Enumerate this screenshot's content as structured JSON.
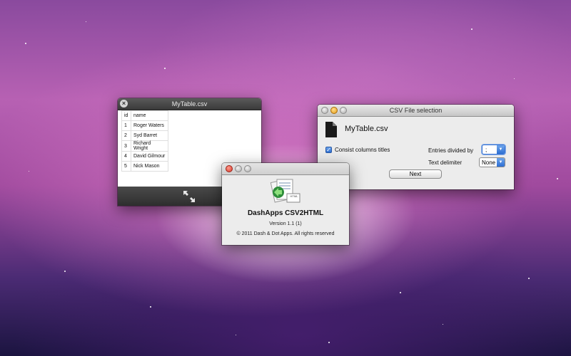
{
  "windows": {
    "mytable": {
      "title": "MyTable.csv",
      "headers": [
        "id",
        "name"
      ],
      "rows": [
        [
          "1",
          "Roger Waters"
        ],
        [
          "2",
          "Syd Barret"
        ],
        [
          "3",
          "Richard Wright"
        ],
        [
          "4",
          "David Gilmour"
        ],
        [
          "5",
          "Nick Mason"
        ]
      ],
      "resize_icon": "fullscreen-arrows-icon"
    },
    "csv": {
      "title": "CSV File selection",
      "file_icon": "document-icon",
      "file_name": "MyTable.csv",
      "checkbox_label": "Consist columns titles",
      "checkbox_checked": true,
      "entries_label": "Entries divided by",
      "entries_value": ";",
      "delimiter_label": "Text delimiter",
      "delimiter_value": "None",
      "next_label": "Next"
    },
    "about": {
      "app_icon": "csv2html-app-icon",
      "icon_text": "HTML",
      "app_name": "DashApps CSV2HTML",
      "version": "Version 1.1 (1)",
      "copyright": "© 2011 Dash & Dot Apps. All rights reserved"
    }
  },
  "colors": {
    "accent_blue": "#2d6ed2",
    "close_red": "#d8392a",
    "minimize_orange": "#e69a19"
  }
}
